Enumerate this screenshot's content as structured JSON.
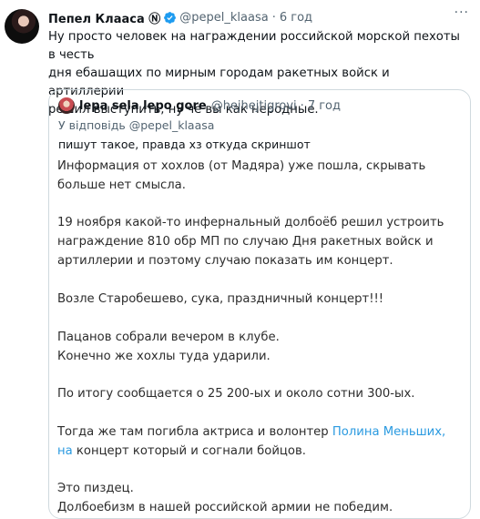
{
  "author": {
    "name": "Пепел Клааса",
    "name_glyph": "Ⓝ",
    "handle": "@pepel_klaasa",
    "separator": "·",
    "time": "6 год"
  },
  "more_label": "···",
  "tweet_text": "Ну просто человек на награждении российской морской пехоты в честь\nдня ебашащих по мирным городам ракетных войск и артиллерии\nрешил выступить, ну че вы как неродные.",
  "quote": {
    "name": "lepa sela lepo gore",
    "handle": "@hejhejtigrovi",
    "separator": "·",
    "time": "7 год",
    "reply_prefix": "У відповідь",
    "reply_to": "@pepel_klaasa",
    "text": "пишут такое, правда хз откуда скриншот"
  },
  "screenshot": {
    "p1_line1": "Информация от хохлов (от Мадяра) уже пошла, скрывать",
    "p1_line2": "больше нет смысла.",
    "p2_line1": "19 ноября какой-то инфернальный долбоёб решил устроить",
    "p2_line2": "награждение 810 обр МП по случаю Дня ракетных войск и",
    "p2_line3": "артиллерии и поэтому случаю показать им концерт.",
    "p3": "Возле Старобешево, сука, праздничный концерт!!!",
    "p4_line1": "Пацанов собрали вечером в клубе.",
    "p4_line2": "Конечно же хохлы туда ударили.",
    "p5": "По итогу сообщается о 25 200-ых и около сотни 300-ых.",
    "p6_line1_prefix": "Тогда же там погибла актриса и волонтер ",
    "p6_line1_link": "Полина Меньших,",
    "p6_line2_link": "на",
    "p6_line2_rest": " концерт который и согнали бойцов.",
    "p7_line1": "Это пиздец.",
    "p7_line2": "Долбоебизм в нашей российской армии не победим."
  },
  "colors": {
    "verified": "#1d9bf0",
    "link": "#2a9ae0",
    "muted": "#536471",
    "border": "#cfd9de"
  }
}
